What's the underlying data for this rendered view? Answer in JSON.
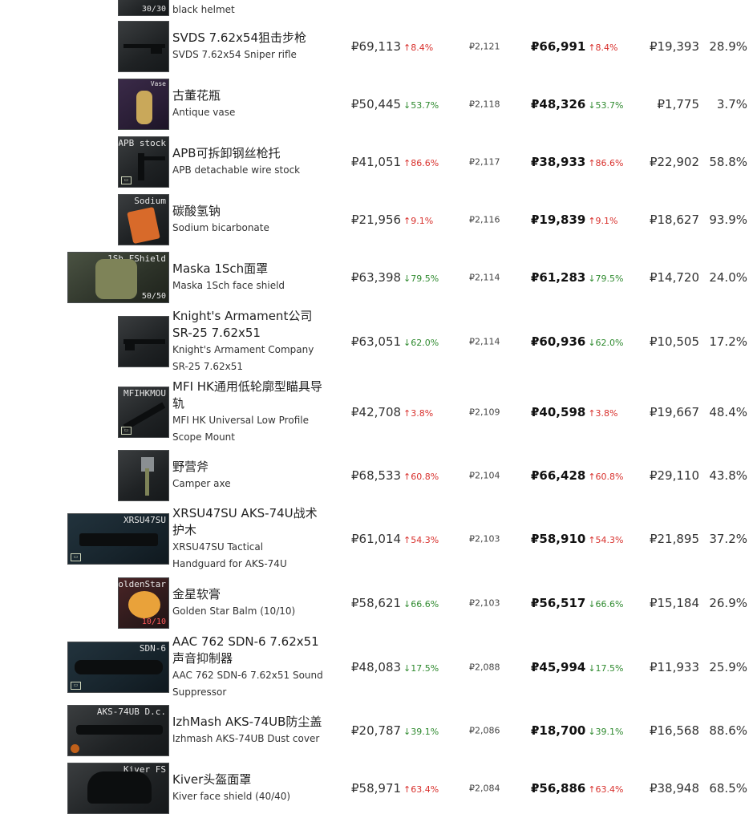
{
  "currency": "₽",
  "colors": {
    "up": "#d8302c",
    "down": "#2f8a2f"
  },
  "rows": [
    {
      "cn": "",
      "en": "black helmet",
      "thumb_tag": "",
      "thumb_count": "30/30",
      "price": "",
      "price_delta": "",
      "slot_price": "",
      "sell_price": "",
      "sell_delta": "",
      "profit": "",
      "percent": ""
    },
    {
      "cn": "SVDS 7.62x54狙击步枪",
      "en": "SVDS 7.62x54 Sniper rifle",
      "thumb_tag": "",
      "thumb_count": "",
      "price": "₽69,113",
      "price_delta": "↑8.4%",
      "slot_price": "₽2,121",
      "sell_price": "₽66,991",
      "sell_delta": "↑8.4%",
      "profit": "₽19,393",
      "percent": "28.9%"
    },
    {
      "cn": "古董花瓶",
      "en": "Antique vase",
      "thumb_tag": "Vase",
      "thumb_count": "",
      "price": "₽50,445",
      "price_delta": "↓53.7%",
      "slot_price": "₽2,118",
      "sell_price": "₽48,326",
      "sell_delta": "↓53.7%",
      "profit": "₽1,775",
      "percent": "3.7%"
    },
    {
      "cn": "APB可拆卸钢丝枪托",
      "en": "APB detachable wire stock",
      "thumb_tag": "APB stock",
      "thumb_count": "",
      "price": "₽41,051",
      "price_delta": "↑86.6%",
      "slot_price": "₽2,117",
      "sell_price": "₽38,933",
      "sell_delta": "↑86.6%",
      "profit": "₽22,902",
      "percent": "58.8%"
    },
    {
      "cn": "碳酸氢钠",
      "en": "Sodium bicarbonate",
      "thumb_tag": "Sodium",
      "thumb_count": "",
      "price": "₽21,956",
      "price_delta": "↑9.1%",
      "slot_price": "₽2,116",
      "sell_price": "₽19,839",
      "sell_delta": "↑9.1%",
      "profit": "₽18,627",
      "percent": "93.9%"
    },
    {
      "cn": "Maska 1Sch面罩",
      "en": "Maska 1Sch face shield",
      "thumb_tag": "1Sh FShield",
      "thumb_count": "50/50",
      "price": "₽63,398",
      "price_delta": "↓79.5%",
      "slot_price": "₽2,114",
      "sell_price": "₽61,283",
      "sell_delta": "↓79.5%",
      "profit": "₽14,720",
      "percent": "24.0%"
    },
    {
      "cn": "Knight's Armament公司 SR-25 7.62x51",
      "en": "Knight's Armament Company SR-25 7.62x51",
      "thumb_tag": "",
      "thumb_count": "",
      "price": "₽63,051",
      "price_delta": "↓62.0%",
      "slot_price": "₽2,114",
      "sell_price": "₽60,936",
      "sell_delta": "↓62.0%",
      "profit": "₽10,505",
      "percent": "17.2%"
    },
    {
      "cn": "MFI HK通用低轮廓型瞄具导轨",
      "en": "MFI HK Universal Low Profile Scope Mount",
      "thumb_tag": "MFIHKMOU",
      "thumb_count": "",
      "price": "₽42,708",
      "price_delta": "↑3.8%",
      "slot_price": "₽2,109",
      "sell_price": "₽40,598",
      "sell_delta": "↑3.8%",
      "profit": "₽19,667",
      "percent": "48.4%"
    },
    {
      "cn": "野营斧",
      "en": "Camper axe",
      "thumb_tag": "",
      "thumb_count": "",
      "price": "₽68,533",
      "price_delta": "↑60.8%",
      "slot_price": "₽2,104",
      "sell_price": "₽66,428",
      "sell_delta": "↑60.8%",
      "profit": "₽29,110",
      "percent": "43.8%"
    },
    {
      "cn": "XRSU47SU AKS-74U战术护木",
      "en": "XRSU47SU Tactical Handguard for AKS-74U",
      "thumb_tag": "XRSU47SU",
      "thumb_count": "",
      "price": "₽61,014",
      "price_delta": "↑54.3%",
      "slot_price": "₽2,103",
      "sell_price": "₽58,910",
      "sell_delta": "↑54.3%",
      "profit": "₽21,895",
      "percent": "37.2%"
    },
    {
      "cn": "金星软膏",
      "en": "Golden Star Balm (10/10)",
      "thumb_tag": "GoldenStar",
      "thumb_count": "10/10",
      "price": "₽58,621",
      "price_delta": "↓66.6%",
      "slot_price": "₽2,103",
      "sell_price": "₽56,517",
      "sell_delta": "↓66.6%",
      "profit": "₽15,184",
      "percent": "26.9%"
    },
    {
      "cn": "AAC 762 SDN-6 7.62x51声音抑制器",
      "en": "AAC 762 SDN-6 7.62x51 Sound Suppressor",
      "thumb_tag": "SDN-6",
      "thumb_count": "",
      "price": "₽48,083",
      "price_delta": "↓17.5%",
      "slot_price": "₽2,088",
      "sell_price": "₽45,994",
      "sell_delta": "↓17.5%",
      "profit": "₽11,933",
      "percent": "25.9%"
    },
    {
      "cn": "IzhMash AKS-74UB防尘盖",
      "en": "Izhmash AKS-74UB Dust cover",
      "thumb_tag": "AKS-74UB D.c.",
      "thumb_count": "",
      "price": "₽20,787",
      "price_delta": "↓39.1%",
      "slot_price": "₽2,086",
      "sell_price": "₽18,700",
      "sell_delta": "↓39.1%",
      "profit": "₽16,568",
      "percent": "88.6%"
    },
    {
      "cn": "Kiver头盔面罩",
      "en": "Kiver face shield (40/40)",
      "thumb_tag": "Kiver FS",
      "thumb_count": "",
      "price": "₽58,971",
      "price_delta": "↑63.4%",
      "slot_price": "₽2,084",
      "sell_price": "₽56,886",
      "sell_delta": "↑63.4%",
      "profit": "₽38,948",
      "percent": "68.5%"
    }
  ]
}
